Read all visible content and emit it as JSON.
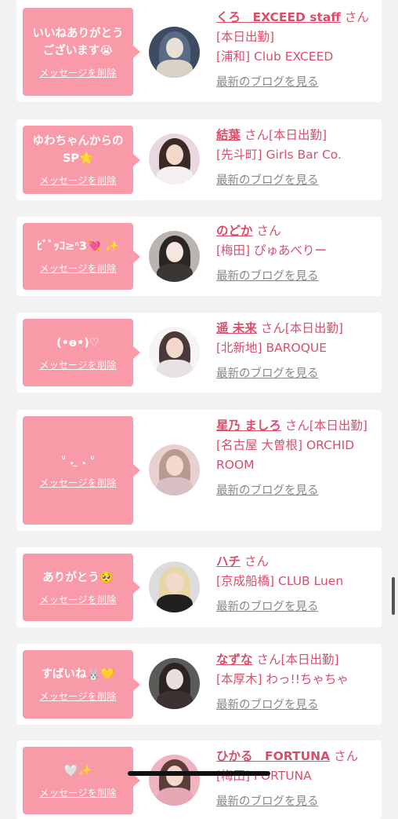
{
  "delete_label": "メッセージを削除",
  "blog_label": "最新のブログを見る",
  "san_label": "さん",
  "colors": {
    "bubble": "#f99aa8",
    "name": "#d94f6a",
    "link_gray": "#888888",
    "background": "#f2f2f2"
  },
  "cards": [
    {
      "message": "いいねありがとう\nございます😭",
      "name": "くろ　EXCEED staff",
      "status": "[本日出勤]",
      "shop": "[浦和] Club EXCEED",
      "avatar_icon": "person-photo"
    },
    {
      "message": "ゆわちゃんからの\nSP🌟",
      "name": "結葉",
      "status": "[本日出勤]",
      "shop": "[先斗町] Girls Bar Co.",
      "avatar_icon": "person-photo"
    },
    {
      "message": "ﾋﾞﾞｯｺ≥ᐢ3💘 ✨",
      "name": "のどか",
      "status": "",
      "shop": "[梅田] ぴゅあべりー",
      "avatar_icon": "person-photo"
    },
    {
      "message": "(•ө•)♡",
      "name": "遥 未来",
      "status": "[本日出勤]",
      "shop": "[北新地] BAROQUE",
      "avatar_icon": "person-photo"
    },
    {
      "message": "ᐡ . ̫ . ᐡ",
      "name": "星乃 ましろ",
      "status": "[本日出勤]",
      "shop": "[名古屋 大曽根] ORCHID ROOM",
      "avatar_icon": "person-photo"
    },
    {
      "message": "ありがとう🥺",
      "name": "ハチ",
      "status": "",
      "shop": "[京成船橋] CLUB Luen",
      "avatar_icon": "person-photo"
    },
    {
      "message": "すばいね🐰💛",
      "name": "なずな",
      "status": "[本日出勤]",
      "shop": "[本厚木] わっ!!ちゃちゃ",
      "avatar_icon": "person-photo"
    },
    {
      "message": "🤍✨",
      "name": "ひかる　FORTUNA",
      "status": "",
      "shop": "[梅田] FORTUNA",
      "avatar_icon": "person-photo"
    }
  ]
}
